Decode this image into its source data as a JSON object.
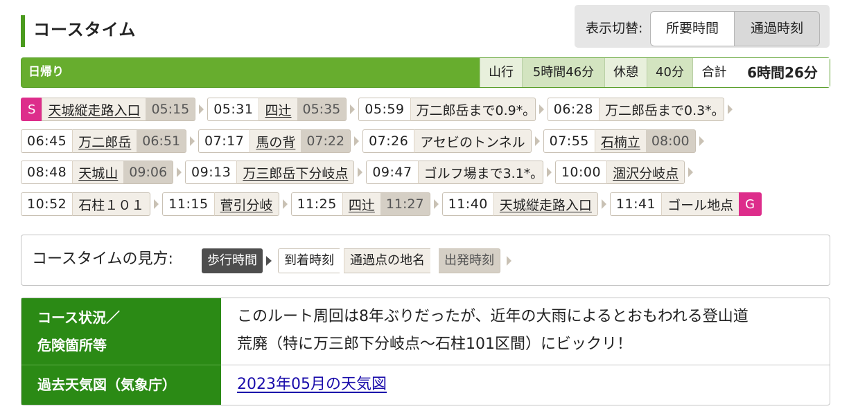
{
  "header": {
    "title": "コースタイム",
    "toggle_label": "表示切替:",
    "toggle_required": "所要時間",
    "toggle_passing": "通過時刻"
  },
  "summary": {
    "label": "日帰り",
    "walk_head": "山行",
    "walk_val": "5時間46分",
    "rest_head": "休憩",
    "rest_val": "40分",
    "total_head": "合計",
    "total_val": "6時間26分"
  },
  "route": {
    "start_badge": "S",
    "goal_badge": "G",
    "rows": [
      [
        {
          "arr": "",
          "name": "天城縦走路入口",
          "dep": "05:15",
          "link": true,
          "start": true
        },
        {
          "arr": "05:31",
          "name": "四辻",
          "dep": "05:35",
          "link": true
        },
        {
          "arr": "05:59",
          "name": "万二郎岳まで0.9*｡",
          "dep": "",
          "link": false
        },
        {
          "arr": "06:28",
          "name": "万二郎岳まで0.3*｡",
          "dep": "",
          "link": false
        }
      ],
      [
        {
          "arr": "06:45",
          "name": "万二郎岳",
          "dep": "06:51",
          "link": true
        },
        {
          "arr": "07:17",
          "name": "馬の背",
          "dep": "07:22",
          "link": true
        },
        {
          "arr": "07:26",
          "name": "アセビのトンネル",
          "dep": "",
          "link": false
        },
        {
          "arr": "07:55",
          "name": "石楠立",
          "dep": "08:00",
          "link": true
        }
      ],
      [
        {
          "arr": "08:48",
          "name": "天城山",
          "dep": "09:06",
          "link": true
        },
        {
          "arr": "09:13",
          "name": "万三郎岳下分岐点",
          "dep": "",
          "link": true
        },
        {
          "arr": "09:47",
          "name": "ゴルフ場まで3.1*｡",
          "dep": "",
          "link": false
        },
        {
          "arr": "10:00",
          "name": "涸沢分岐点",
          "dep": "",
          "link": true
        }
      ],
      [
        {
          "arr": "10:52",
          "name": "石柱１０１",
          "dep": "",
          "link": false
        },
        {
          "arr": "11:15",
          "name": "菅引分岐",
          "dep": "",
          "link": true
        },
        {
          "arr": "11:25",
          "name": "四辻",
          "dep": "11:27",
          "link": true
        },
        {
          "arr": "11:40",
          "name": "天城縦走路入口",
          "dep": "",
          "link": true
        },
        {
          "arr": "11:41",
          "name": "ゴール地点",
          "dep": "",
          "link": false,
          "goal": true
        }
      ]
    ]
  },
  "legend": {
    "title": "コースタイムの見方:",
    "walk": "歩行時間",
    "arrive": "到着時刻",
    "place": "通過点の地名",
    "depart": "出発時刻"
  },
  "info": {
    "status_header_line1": "コース状況／",
    "status_header_line2": "危険箇所等",
    "status_line1": "このルート周回は8年ぶりだったが、近年の大雨によるとおもわれる登山道",
    "status_line2": "荒廃（特に万三郎下分岐点〜石柱101区間）にビックリ！",
    "weather_header": "過去天気図（気象庁）",
    "weather_link": "2023年05月の天気図"
  }
}
